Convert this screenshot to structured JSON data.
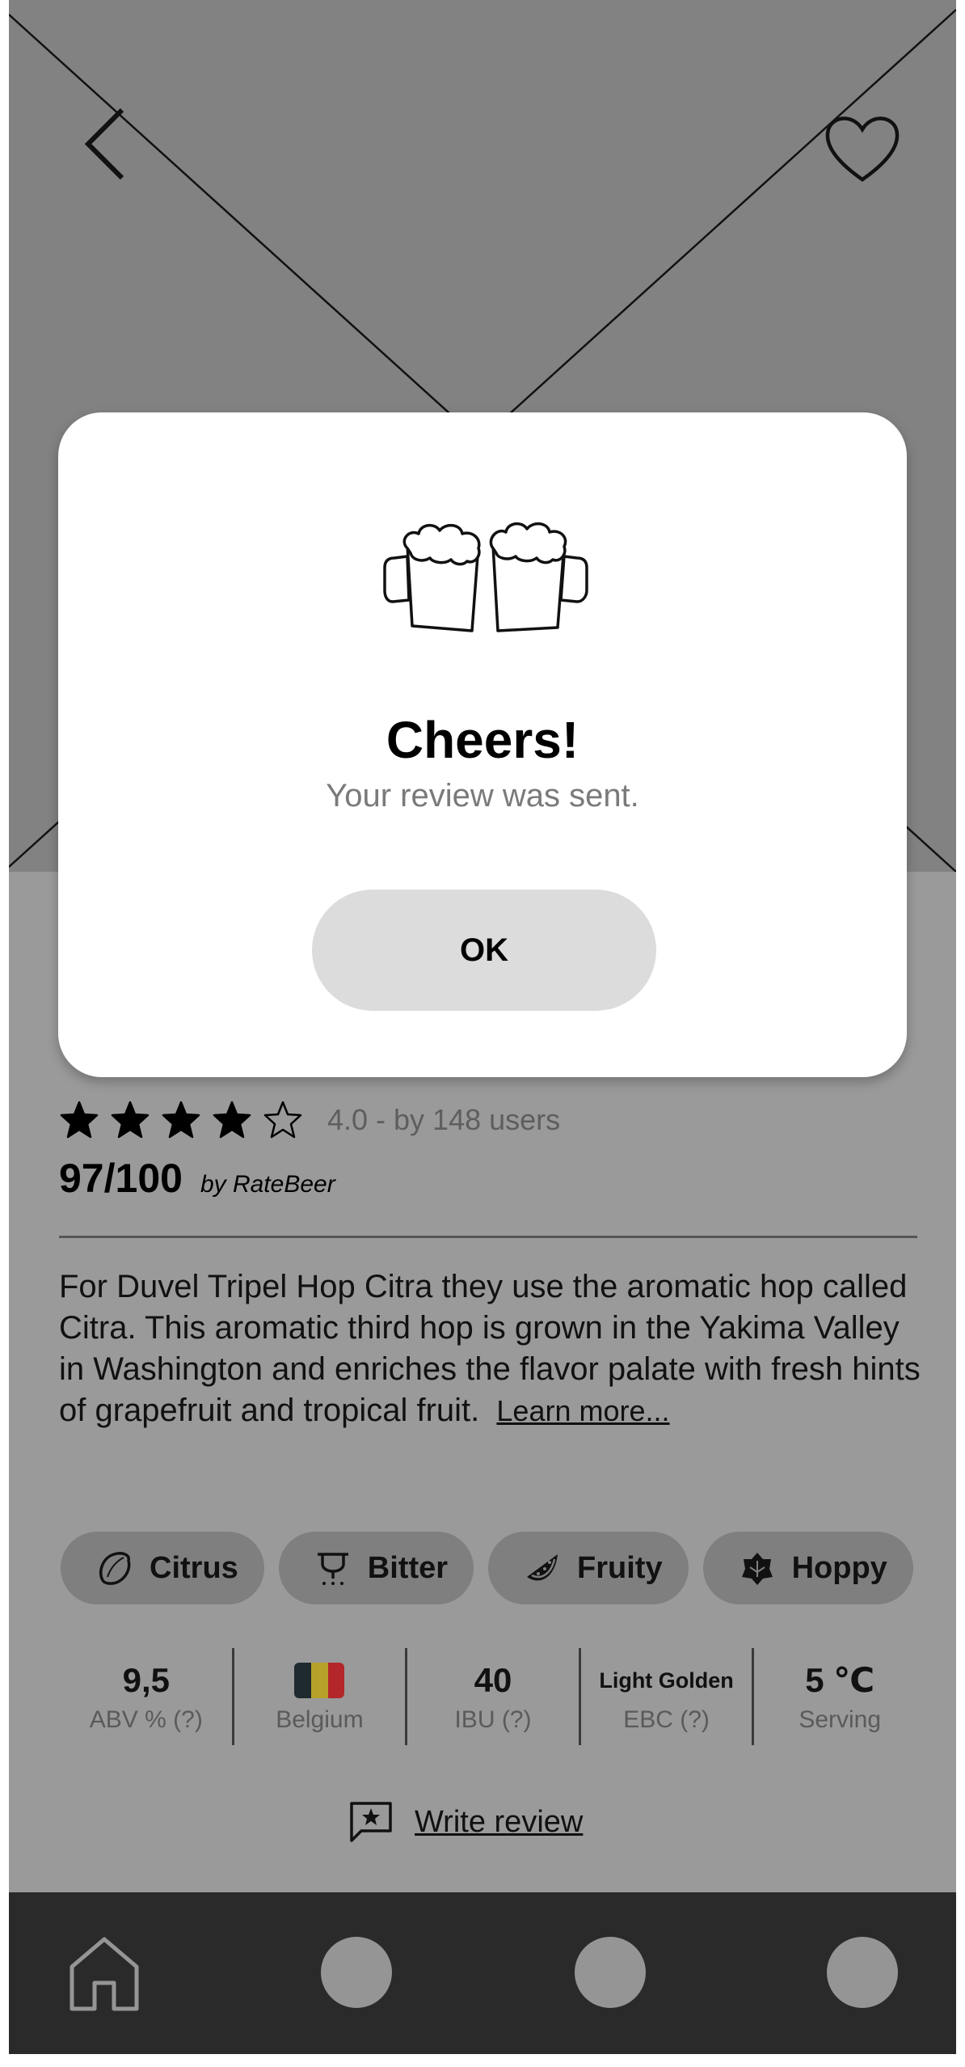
{
  "hero": {
    "back_icon": "chevron-left-icon",
    "favorite_icon": "heart-icon"
  },
  "rating": {
    "stars_filled": 4,
    "stars_total": 5,
    "text": "4.0 -  by 148 users"
  },
  "score": {
    "value": "97/100",
    "source": "by RateBeer"
  },
  "description": {
    "text": "For Duvel Tripel Hop Citra they use the aromatic hop called Citra. This aromatic third hop is grown in the Yakima Valley in Washington and enriches the flavor palate with fresh hints of grapefruit and tropical fruit.",
    "learn_more": "Learn more..."
  },
  "tags": [
    {
      "label": "Citrus",
      "icon": "lemon-icon"
    },
    {
      "label": "Bitter",
      "icon": "bitter-icon"
    },
    {
      "label": "Fruity",
      "icon": "watermelon-icon"
    },
    {
      "label": "Hoppy",
      "icon": "hop-icon"
    }
  ],
  "stats": [
    {
      "value": "9,5",
      "label": "ABV % (?)"
    },
    {
      "value": "",
      "label": "Belgium",
      "flag_colors": [
        "#1f2a2e",
        "#b8a12a",
        "#b3262a"
      ]
    },
    {
      "value": "40",
      "label": "IBU (?)"
    },
    {
      "value": "Light Golden",
      "label": "EBC (?)"
    },
    {
      "value": "5 ℃",
      "label": "Serving"
    }
  ],
  "write_review": {
    "label": "Write review",
    "icon": "star-message-icon"
  },
  "navbar": {
    "items": [
      "home-icon",
      "nav-item-2",
      "nav-item-3",
      "nav-item-4"
    ]
  },
  "modal": {
    "icon": "beer-mugs-cheers-icon",
    "title": "Cheers!",
    "subtitle": "Your review was sent.",
    "ok_label": "OK"
  },
  "colors": {
    "background": "#9a9a9a",
    "hero": "#828282",
    "chip": "#7f7f7f",
    "navbar": "#2a2a2a",
    "modal": "#ffffff",
    "ok_button": "#dcdcdc"
  }
}
